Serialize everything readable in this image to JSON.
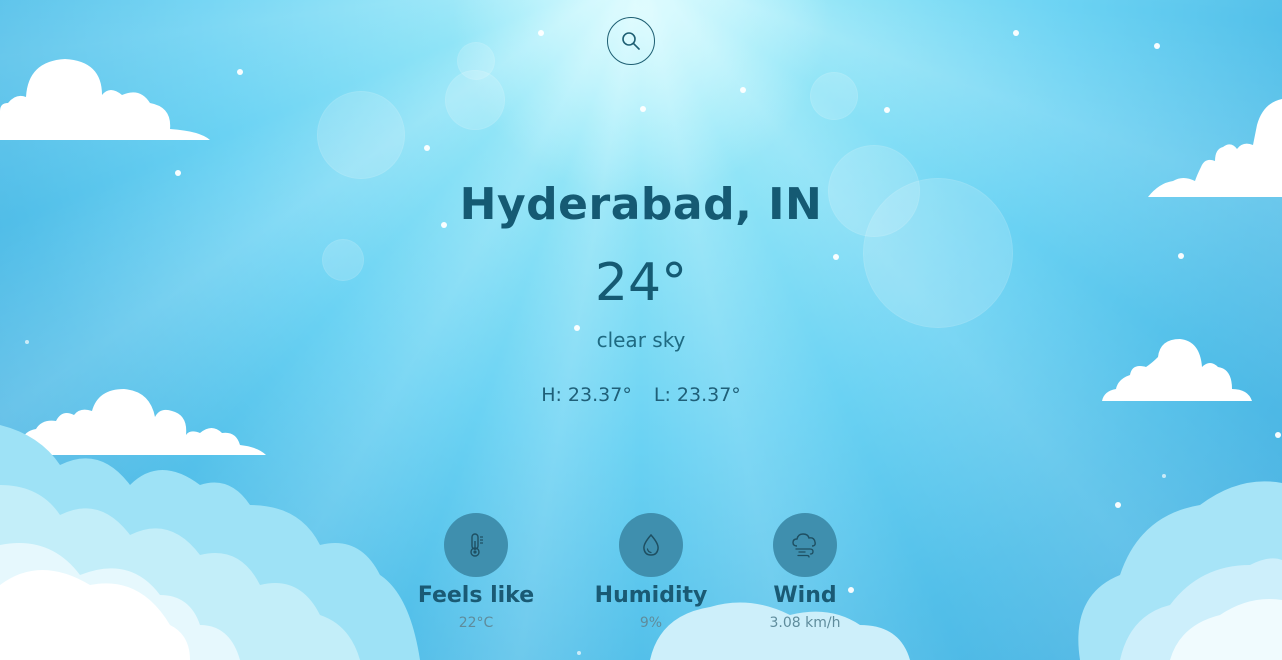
{
  "search": {
    "icon": "search-icon"
  },
  "location": {
    "city": "Hyderabad, IN"
  },
  "current": {
    "temperature": "24°",
    "description": "clear sky",
    "high": "H: 23.37°",
    "low": "L: 23.37°"
  },
  "stats": [
    {
      "icon": "thermometer-icon",
      "title": "Feels like",
      "value": "22°C"
    },
    {
      "icon": "water-drop-icon",
      "title": "Humidity",
      "value": "9%"
    },
    {
      "icon": "wind-cloud-icon",
      "title": "Wind",
      "value": "3.08 km/h"
    }
  ],
  "colors": {
    "text_primary": "#155a73",
    "icon_circle": "#3f8fae",
    "sky_top": "#b9f3fb",
    "sky_bottom": "#45addf"
  }
}
